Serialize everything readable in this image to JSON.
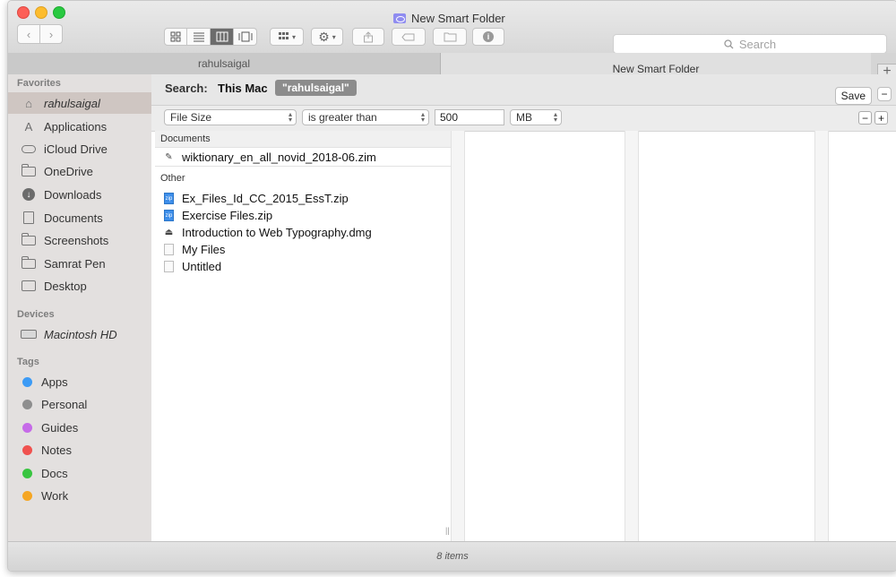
{
  "window": {
    "title": "New Smart Folder",
    "accent_color": "#8f8cf0"
  },
  "toolbar": {
    "back_icon": "chevron-left-icon",
    "forward_icon": "chevron-right-icon",
    "search_placeholder": "Search"
  },
  "tabs": [
    {
      "label": "rahulsaigal"
    },
    {
      "label": "New Smart Folder"
    }
  ],
  "sidebar": {
    "favorites_heading": "Favorites",
    "favorites": [
      {
        "label": "rahulsaigal",
        "icon": "home-icon",
        "selected": true
      },
      {
        "label": "Applications",
        "icon": "applications-icon"
      },
      {
        "label": "iCloud Drive",
        "icon": "cloud-icon"
      },
      {
        "label": "OneDrive",
        "icon": "folder-icon"
      },
      {
        "label": "Downloads",
        "icon": "download-icon"
      },
      {
        "label": "Documents",
        "icon": "documents-icon"
      },
      {
        "label": "Screenshots",
        "icon": "folder-icon"
      },
      {
        "label": "Samrat Pen",
        "icon": "folder-icon"
      },
      {
        "label": "Desktop",
        "icon": "desktop-icon"
      }
    ],
    "devices_heading": "Devices",
    "devices": [
      {
        "label": "Macintosh HD",
        "icon": "disk-icon"
      }
    ],
    "tags_heading": "Tags",
    "tags": [
      {
        "label": "Apps",
        "color": "#3d9bf5"
      },
      {
        "label": "Personal",
        "color": "#8e8e8e"
      },
      {
        "label": "Guides",
        "color": "#c66be8"
      },
      {
        "label": "Notes",
        "color": "#f0524f"
      },
      {
        "label": "Docs",
        "color": "#39c541"
      },
      {
        "label": "Work",
        "color": "#f5a623"
      }
    ]
  },
  "searchbar": {
    "label": "Search:",
    "scope_this_mac": "This Mac",
    "scope_user": "\"rahulsaigal\"",
    "save_label": "Save",
    "remove_label": "−"
  },
  "criteria": {
    "attribute": "File Size",
    "operator": "is greater than",
    "value": "500",
    "unit": "MB",
    "remove_label": "−",
    "add_label": "+"
  },
  "results": {
    "groups": [
      {
        "name": "Documents",
        "files": [
          {
            "name": "wiktionary_en_all_novid_2018-06.zim",
            "kind": "zim"
          }
        ]
      },
      {
        "name": "Other",
        "files": [
          {
            "name": "Ex_Files_Id_CC_2015_EssT.zip",
            "kind": "zip"
          },
          {
            "name": "Exercise Files.zip",
            "kind": "zip"
          },
          {
            "name": "Introduction to Web Typography.dmg",
            "kind": "dmg"
          },
          {
            "name": "My Files",
            "kind": "blank"
          },
          {
            "name": "Untitled",
            "kind": "blank"
          }
        ]
      }
    ]
  },
  "status": {
    "item_count": "8 items"
  }
}
